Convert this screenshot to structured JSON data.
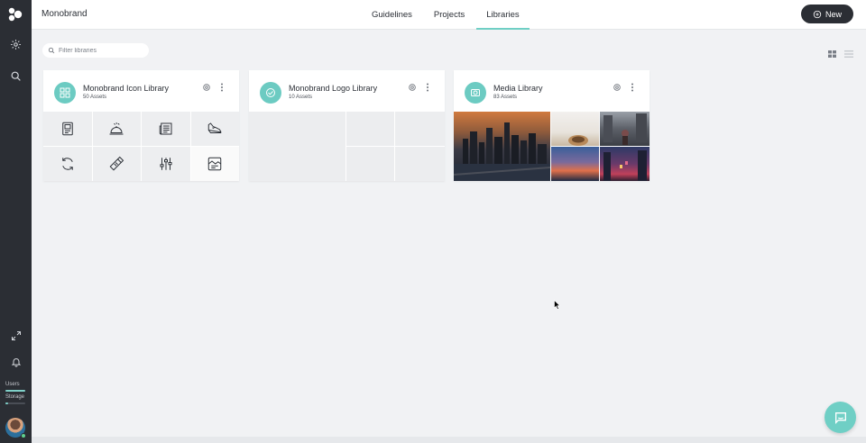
{
  "app": {
    "brand": "Monobrand"
  },
  "nav": {
    "tabs": [
      {
        "label": "Guidelines",
        "active": false
      },
      {
        "label": "Projects",
        "active": false
      },
      {
        "label": "Libraries",
        "active": true
      }
    ]
  },
  "toolbar": {
    "new_label": "New"
  },
  "filter": {
    "placeholder": "Filter libraries",
    "value": ""
  },
  "sidebar": {
    "icons": [
      "logo-icon",
      "settings-icon",
      "search-icon",
      "expand-icon",
      "bell-icon"
    ],
    "users_label": "Users",
    "storage_label": "Storage",
    "users_fill": 1.0,
    "storage_fill": 0.15
  },
  "libraries": [
    {
      "title": "Monobrand Icon Library",
      "assets": "50 Assets",
      "icons": [
        "printer-icon",
        "service-bell-icon",
        "newspaper-icon",
        "sneaker-icon",
        "refresh-icon",
        "usb-drive-icon",
        "sliders-icon",
        "image-card-icon"
      ]
    },
    {
      "title": "Monobrand Logo Library",
      "assets": "10 Assets"
    },
    {
      "title": "Media Library",
      "assets": "83 Assets"
    }
  ],
  "colors": {
    "accent": "#6fcfc5",
    "sidebar": "#2b2e34",
    "background": "#f1f2f4"
  }
}
